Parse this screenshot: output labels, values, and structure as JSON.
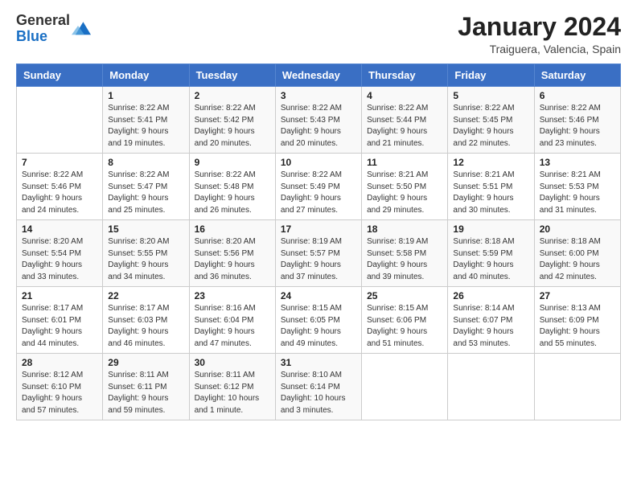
{
  "logo": {
    "general": "General",
    "blue": "Blue"
  },
  "header": {
    "month": "January 2024",
    "location": "Traiguera, Valencia, Spain"
  },
  "weekdays": [
    "Sunday",
    "Monday",
    "Tuesday",
    "Wednesday",
    "Thursday",
    "Friday",
    "Saturday"
  ],
  "weeks": [
    [
      {
        "day": "",
        "info": ""
      },
      {
        "day": "1",
        "info": "Sunrise: 8:22 AM\nSunset: 5:41 PM\nDaylight: 9 hours\nand 19 minutes."
      },
      {
        "day": "2",
        "info": "Sunrise: 8:22 AM\nSunset: 5:42 PM\nDaylight: 9 hours\nand 20 minutes."
      },
      {
        "day": "3",
        "info": "Sunrise: 8:22 AM\nSunset: 5:43 PM\nDaylight: 9 hours\nand 20 minutes."
      },
      {
        "day": "4",
        "info": "Sunrise: 8:22 AM\nSunset: 5:44 PM\nDaylight: 9 hours\nand 21 minutes."
      },
      {
        "day": "5",
        "info": "Sunrise: 8:22 AM\nSunset: 5:45 PM\nDaylight: 9 hours\nand 22 minutes."
      },
      {
        "day": "6",
        "info": "Sunrise: 8:22 AM\nSunset: 5:46 PM\nDaylight: 9 hours\nand 23 minutes."
      }
    ],
    [
      {
        "day": "7",
        "info": "Sunrise: 8:22 AM\nSunset: 5:46 PM\nDaylight: 9 hours\nand 24 minutes."
      },
      {
        "day": "8",
        "info": "Sunrise: 8:22 AM\nSunset: 5:47 PM\nDaylight: 9 hours\nand 25 minutes."
      },
      {
        "day": "9",
        "info": "Sunrise: 8:22 AM\nSunset: 5:48 PM\nDaylight: 9 hours\nand 26 minutes."
      },
      {
        "day": "10",
        "info": "Sunrise: 8:22 AM\nSunset: 5:49 PM\nDaylight: 9 hours\nand 27 minutes."
      },
      {
        "day": "11",
        "info": "Sunrise: 8:21 AM\nSunset: 5:50 PM\nDaylight: 9 hours\nand 29 minutes."
      },
      {
        "day": "12",
        "info": "Sunrise: 8:21 AM\nSunset: 5:51 PM\nDaylight: 9 hours\nand 30 minutes."
      },
      {
        "day": "13",
        "info": "Sunrise: 8:21 AM\nSunset: 5:53 PM\nDaylight: 9 hours\nand 31 minutes."
      }
    ],
    [
      {
        "day": "14",
        "info": "Sunrise: 8:20 AM\nSunset: 5:54 PM\nDaylight: 9 hours\nand 33 minutes."
      },
      {
        "day": "15",
        "info": "Sunrise: 8:20 AM\nSunset: 5:55 PM\nDaylight: 9 hours\nand 34 minutes."
      },
      {
        "day": "16",
        "info": "Sunrise: 8:20 AM\nSunset: 5:56 PM\nDaylight: 9 hours\nand 36 minutes."
      },
      {
        "day": "17",
        "info": "Sunrise: 8:19 AM\nSunset: 5:57 PM\nDaylight: 9 hours\nand 37 minutes."
      },
      {
        "day": "18",
        "info": "Sunrise: 8:19 AM\nSunset: 5:58 PM\nDaylight: 9 hours\nand 39 minutes."
      },
      {
        "day": "19",
        "info": "Sunrise: 8:18 AM\nSunset: 5:59 PM\nDaylight: 9 hours\nand 40 minutes."
      },
      {
        "day": "20",
        "info": "Sunrise: 8:18 AM\nSunset: 6:00 PM\nDaylight: 9 hours\nand 42 minutes."
      }
    ],
    [
      {
        "day": "21",
        "info": "Sunrise: 8:17 AM\nSunset: 6:01 PM\nDaylight: 9 hours\nand 44 minutes."
      },
      {
        "day": "22",
        "info": "Sunrise: 8:17 AM\nSunset: 6:03 PM\nDaylight: 9 hours\nand 46 minutes."
      },
      {
        "day": "23",
        "info": "Sunrise: 8:16 AM\nSunset: 6:04 PM\nDaylight: 9 hours\nand 47 minutes."
      },
      {
        "day": "24",
        "info": "Sunrise: 8:15 AM\nSunset: 6:05 PM\nDaylight: 9 hours\nand 49 minutes."
      },
      {
        "day": "25",
        "info": "Sunrise: 8:15 AM\nSunset: 6:06 PM\nDaylight: 9 hours\nand 51 minutes."
      },
      {
        "day": "26",
        "info": "Sunrise: 8:14 AM\nSunset: 6:07 PM\nDaylight: 9 hours\nand 53 minutes."
      },
      {
        "day": "27",
        "info": "Sunrise: 8:13 AM\nSunset: 6:09 PM\nDaylight: 9 hours\nand 55 minutes."
      }
    ],
    [
      {
        "day": "28",
        "info": "Sunrise: 8:12 AM\nSunset: 6:10 PM\nDaylight: 9 hours\nand 57 minutes."
      },
      {
        "day": "29",
        "info": "Sunrise: 8:11 AM\nSunset: 6:11 PM\nDaylight: 9 hours\nand 59 minutes."
      },
      {
        "day": "30",
        "info": "Sunrise: 8:11 AM\nSunset: 6:12 PM\nDaylight: 10 hours\nand 1 minute."
      },
      {
        "day": "31",
        "info": "Sunrise: 8:10 AM\nSunset: 6:14 PM\nDaylight: 10 hours\nand 3 minutes."
      },
      {
        "day": "",
        "info": ""
      },
      {
        "day": "",
        "info": ""
      },
      {
        "day": "",
        "info": ""
      }
    ]
  ]
}
